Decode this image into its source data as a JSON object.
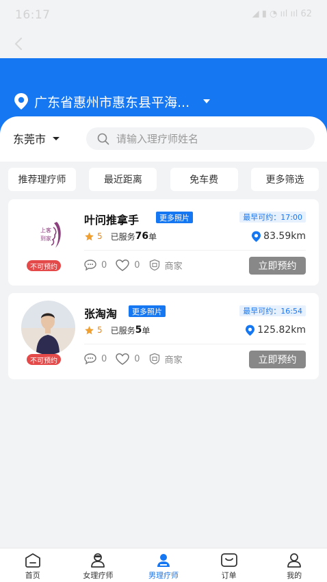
{
  "status_bar": {
    "time": "16:17",
    "icons_text": "◢ ▮ ◔ ııl ııl 62"
  },
  "header": {
    "location": "广东省惠州市惠东县平海..."
  },
  "search": {
    "city": "东莞市",
    "placeholder": "请输入理疗师姓名"
  },
  "filters": [
    "推荐理疗师",
    "最近距离",
    "免车费",
    "更多筛选"
  ],
  "therapists": [
    {
      "name": "叶问推拿手",
      "more_photos": "更多照片",
      "earliest": "最早可约：17:00",
      "rating": "5",
      "served_prefix": "已服务",
      "served_count": "76",
      "served_unit": "单",
      "distance": "83.59km",
      "comments": "0",
      "likes": "0",
      "merchant": "商家",
      "status_badge": "不可预约",
      "book_label": "立即预约"
    },
    {
      "name": "张淘淘",
      "more_photos": "更多照片",
      "earliest": "最早可约：16:54",
      "rating": "5",
      "served_prefix": "已服务",
      "served_count": "5",
      "served_unit": "单",
      "distance": "125.82km",
      "comments": "0",
      "likes": "0",
      "merchant": "商家",
      "status_badge": "不可预约",
      "book_label": "立即预约"
    }
  ],
  "logo_text": "上客到家",
  "tabs": [
    {
      "label": "首页",
      "icon": "home-icon"
    },
    {
      "label": "女理疗师",
      "icon": "female-therapist-icon"
    },
    {
      "label": "男理疗师",
      "icon": "male-therapist-icon",
      "active": true
    },
    {
      "label": "订单",
      "icon": "order-icon"
    },
    {
      "label": "我的",
      "icon": "profile-icon"
    }
  ],
  "colors": {
    "brand_blue": "#1677f2",
    "badge_red": "#e44a4a",
    "rating_orange": "#e88a1a",
    "disabled_gray": "#888888"
  }
}
